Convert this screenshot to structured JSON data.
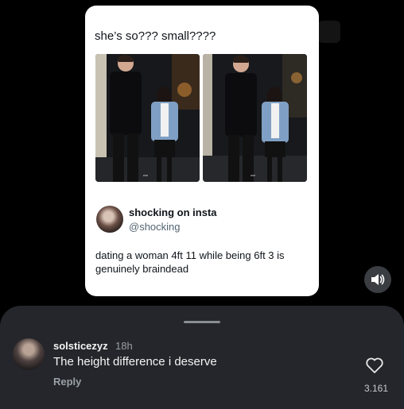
{
  "post": {
    "caption": "she’s so??? small????",
    "quoted_tweet": {
      "display_name": "shocking on insta",
      "handle": "@shocking",
      "text": "dating a woman 4ft 11 while being 6ft 3 is genuinely braindead"
    },
    "images": [
      {
        "icon": "photo-couple-walking-left"
      },
      {
        "icon": "photo-couple-walking-right"
      }
    ]
  },
  "controls": {
    "volume_icon": "speaker-volume-icon"
  },
  "comment": {
    "username": "solsticezyz",
    "time": "18h",
    "text": "The height difference i deserve",
    "reply_label": "Reply",
    "like_count": "3.161"
  },
  "colors": {
    "background": "#000000",
    "card": "#ffffff",
    "sheet": "#24262b",
    "muted_text": "#9aa0a6"
  }
}
